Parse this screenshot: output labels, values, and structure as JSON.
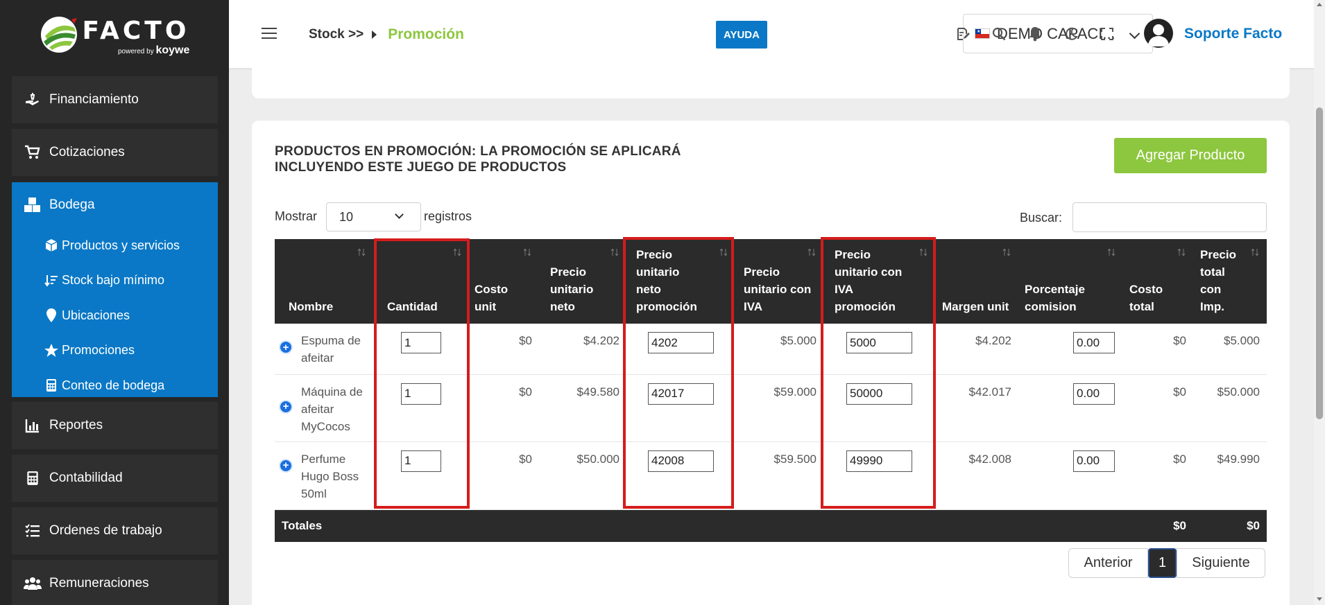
{
  "brand": {
    "name": "FACTO",
    "powered_by": "powered by",
    "by_company": "koywe"
  },
  "sidebar": {
    "items_top": [
      {
        "label": "Financiamiento",
        "icon": "hand-money-icon"
      },
      {
        "label": "Cotizaciones",
        "icon": "cart-icon"
      }
    ],
    "group": {
      "label": "Bodega",
      "icon": "boxes-icon",
      "children": [
        {
          "label": "Productos y servicios",
          "icon": "box-icon"
        },
        {
          "label": "Stock bajo mínimo",
          "icon": "sort-amount-down-icon"
        },
        {
          "label": "Ubicaciones",
          "icon": "map-pin-icon"
        },
        {
          "label": "Promociones",
          "icon": "star-icon"
        },
        {
          "label": "Conteo de bodega",
          "icon": "calculator-icon"
        }
      ]
    },
    "items_bottom": [
      {
        "label": "Reportes",
        "icon": "bar-chart-icon"
      },
      {
        "label": "Contabilidad",
        "icon": "calculator-icon"
      },
      {
        "label": "Ordenes de trabajo",
        "icon": "task-list-icon"
      },
      {
        "label": "Remuneraciones",
        "icon": "users-icon"
      }
    ]
  },
  "header": {
    "breadcrumb_parent": "Stock >>",
    "breadcrumb_current": "Promoción",
    "help_label": "AYUDA",
    "company": "DEMO CAPACI...",
    "user_name": "Soporte Facto"
  },
  "section": {
    "title": "PRODUCTOS EN PROMOCIÓN: LA PROMOCIÓN SE APLICARÁ INCLUYENDO ESTE JUEGO DE PRODUCTOS",
    "add_button": "Agregar Producto"
  },
  "table_controls": {
    "show_label": "Mostrar",
    "page_size": "10",
    "records_label": "registros",
    "search_label": "Buscar:",
    "search_value": ""
  },
  "table": {
    "columns": [
      "Nombre",
      "Cantidad",
      "Costo unit",
      "Precio unitario neto",
      "Precio unitario neto promoción",
      "Precio unitario con IVA",
      "Precio unitario con IVA promoción",
      "Margen unit",
      "Porcentaje comision",
      "Costo total",
      "Precio total con Imp."
    ],
    "rows": [
      {
        "name": "Espuma de afeitar",
        "cantidad": "1",
        "costo_unit": "$0",
        "precio_neto": "$4.202",
        "neto_promo": "4202",
        "precio_iva": "$5.000",
        "iva_promo": "5000",
        "margen": "$4.202",
        "comision": "0.00",
        "costo_total": "$0",
        "precio_total": "$5.000"
      },
      {
        "name": "Máquina de afeitar MyCocos",
        "cantidad": "1",
        "costo_unit": "$0",
        "precio_neto": "$49.580",
        "neto_promo": "42017",
        "precio_iva": "$59.000",
        "iva_promo": "50000",
        "margen": "$42.017",
        "comision": "0.00",
        "costo_total": "$0",
        "precio_total": "$50.000"
      },
      {
        "name": "Perfume Hugo Boss 50ml",
        "cantidad": "1",
        "costo_unit": "$0",
        "precio_neto": "$50.000",
        "neto_promo": "42008",
        "precio_iva": "$59.500",
        "iva_promo": "49990",
        "margen": "$42.008",
        "comision": "0.00",
        "costo_total": "$0",
        "precio_total": "$49.990"
      }
    ],
    "totals": {
      "label": "Totales",
      "costo_total": "$0",
      "precio_total": "$0"
    }
  },
  "pagination": {
    "prev": "Anterior",
    "current": "1",
    "next": "Siguiente"
  },
  "colors": {
    "primary_blue": "#0a78c6",
    "accent_green": "#8dc63f",
    "highlight_red": "#d51c1c",
    "dark": "#2b2b2b"
  }
}
